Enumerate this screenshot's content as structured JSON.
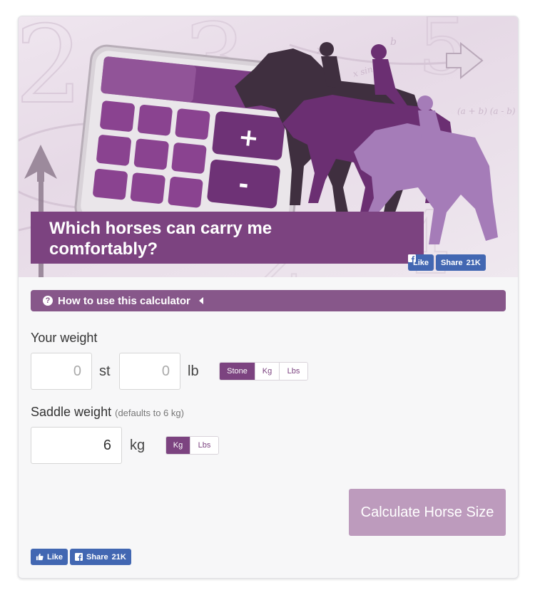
{
  "hero": {
    "title_line1": "Which horses can carry me",
    "title_line2": "comfortably?",
    "like_label": "Like",
    "share_label": "Share",
    "share_count": "21K"
  },
  "howto": {
    "label": "How to use this calculator",
    "icon": "question-circle-icon"
  },
  "your_weight": {
    "label": "Your weight",
    "stone_value": "",
    "stone_placeholder": "0",
    "stone_unit": "st",
    "lb_value": "",
    "lb_placeholder": "0",
    "lb_unit": "lb",
    "units": [
      "Stone",
      "Kg",
      "Lbs"
    ],
    "selected_unit": "Stone"
  },
  "saddle_weight": {
    "label": "Saddle weight",
    "hint": "(defaults to 6 kg)",
    "value": "6",
    "unit": "kg",
    "units": [
      "Kg",
      "Lbs"
    ],
    "selected_unit": "Kg"
  },
  "calculate_label": "Calculate Horse Size",
  "footer": {
    "like_label": "Like",
    "share_label": "Share",
    "share_count": "21K"
  },
  "colors": {
    "brand_purple": "#7c4380",
    "facebook_blue": "#4267b2",
    "calc_button": "#bd9bbd"
  }
}
